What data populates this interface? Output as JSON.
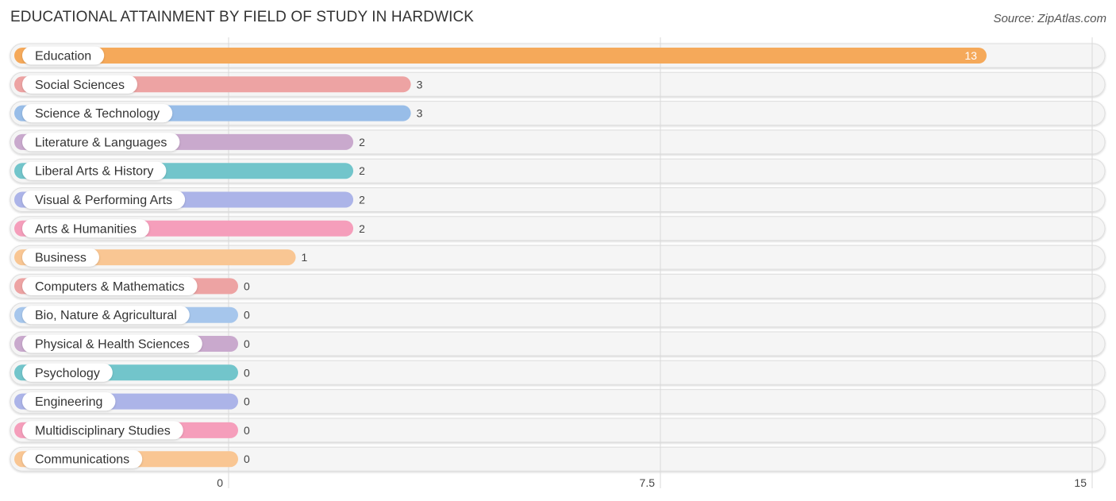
{
  "header": {
    "title": "EDUCATIONAL ATTAINMENT BY FIELD OF STUDY IN HARDWICK",
    "source": "Source: ZipAtlas.com"
  },
  "chart_data": {
    "type": "bar",
    "orientation": "horizontal",
    "title": "EDUCATIONAL ATTAINMENT BY FIELD OF STUDY IN HARDWICK",
    "xlabel": "",
    "ylabel": "",
    "xlim": [
      0,
      15
    ],
    "x_ticks": [
      "0",
      "7.5",
      "15"
    ],
    "x_tick_values": [
      0,
      7.5,
      15
    ],
    "grid": true,
    "categories": [
      "Education",
      "Social Sciences",
      "Science & Technology",
      "Literature & Languages",
      "Liberal Arts & History",
      "Visual & Performing Arts",
      "Arts & Humanities",
      "Business",
      "Computers & Mathematics",
      "Bio, Nature & Agricultural",
      "Physical & Health Sciences",
      "Psychology",
      "Engineering",
      "Multidisciplinary Studies",
      "Communications"
    ],
    "values": [
      13,
      3,
      3,
      2,
      2,
      2,
      2,
      1,
      0,
      0,
      0,
      0,
      0,
      0,
      0
    ],
    "value_labels": [
      "13",
      "3",
      "3",
      "2",
      "2",
      "2",
      "2",
      "1",
      "0",
      "0",
      "0",
      "0",
      "0",
      "0",
      "0"
    ],
    "colors": [
      "#f5a95a",
      "#eda3a3",
      "#98bde8",
      "#c9a9cd",
      "#72c5cb",
      "#acb4e8",
      "#f59ebb",
      "#f9c693",
      "#eda3a3",
      "#a6c6ec",
      "#c9a9cd",
      "#72c5cb",
      "#acb4e8",
      "#f59ebb",
      "#f9c693"
    ]
  }
}
